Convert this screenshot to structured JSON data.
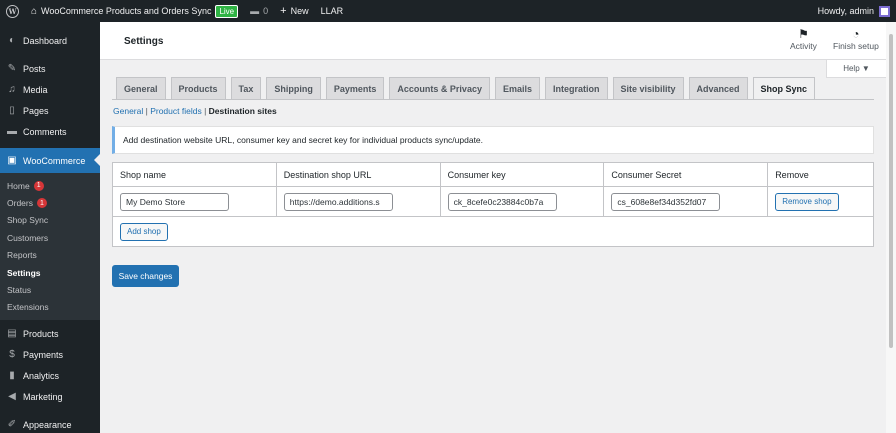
{
  "adminbar": {
    "site_name": "WooCommerce Products and Orders Sync",
    "live_label": "Live",
    "comments_count": "0",
    "new_label": "New",
    "llar_label": "LLAR",
    "howdy": "Howdy, admin"
  },
  "sidebar": {
    "dashboard": "Dashboard",
    "posts": "Posts",
    "media": "Media",
    "pages": "Pages",
    "comments": "Comments",
    "woocommerce": "WooCommerce",
    "sub": {
      "home": "Home",
      "home_count": "1",
      "orders": "Orders",
      "orders_count": "1",
      "shop_sync": "Shop Sync",
      "customers": "Customers",
      "reports": "Reports",
      "settings": "Settings",
      "status": "Status",
      "extensions": "Extensions"
    },
    "products": "Products",
    "payments": "Payments",
    "analytics": "Analytics",
    "marketing": "Marketing",
    "appearance": "Appearance"
  },
  "header": {
    "title": "Settings",
    "activity": "Activity",
    "finish_setup": "Finish setup",
    "help": "Help ▼"
  },
  "tabs": [
    "General",
    "Products",
    "Tax",
    "Shipping",
    "Payments",
    "Accounts & Privacy",
    "Emails",
    "Integration",
    "Site visibility",
    "Advanced",
    "Shop Sync"
  ],
  "subsub": {
    "general": "General",
    "product_fields": "Product fields",
    "destination_sites": "Destination sites"
  },
  "notice": "Add destination website URL, consumer key and secret key for individual products sync/update.",
  "table": {
    "headers": [
      "Shop name",
      "Destination shop URL",
      "Consumer key",
      "Consumer Secret",
      "Remove"
    ],
    "row": {
      "shop_name": "My Demo Store",
      "url": "https://demo.additions.s",
      "key": "ck_8cefe0c23884c0b7a",
      "secret": "cs_608e8ef34d352fd07",
      "remove": "Remove shop"
    },
    "add_shop": "Add shop"
  },
  "save_label": "Save changes"
}
